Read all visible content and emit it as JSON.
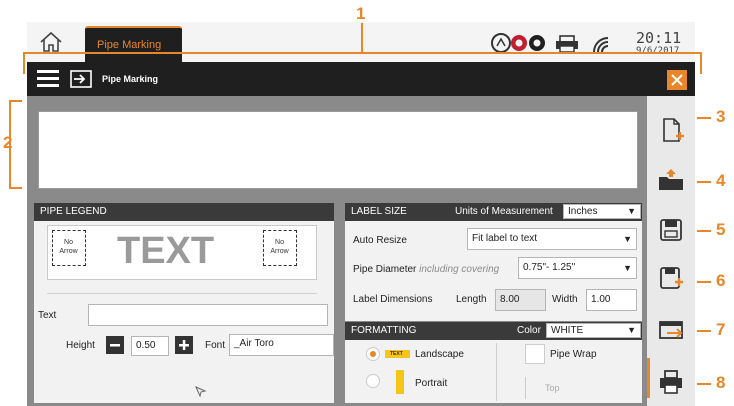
{
  "callouts": {
    "c1": "1",
    "c2": "2",
    "c3": "3",
    "c4": "4",
    "c5": "5",
    "c6": "6",
    "c7": "7",
    "c8": "8"
  },
  "topbar": {
    "tab_label": "Pipe Marking",
    "time": "20:11",
    "date": "9/6/2017"
  },
  "titlebar": {
    "title": "Pipe Marking"
  },
  "pipe_legend": {
    "header": "PIPE LEGEND",
    "left_arrow": [
      "No",
      "Arrow"
    ],
    "legend_text": "TEXT",
    "right_arrow": [
      "No",
      "Arrow"
    ],
    "text_label": "Text",
    "text_value": "",
    "height_label": "Height",
    "height_value": "0.50",
    "font_label": "Font",
    "font_value": "_Air Toro"
  },
  "label_size": {
    "header": "LABEL SIZE",
    "units_label": "Units of Measurement",
    "units_value": "Inches",
    "auto_resize_label": "Auto Resize",
    "auto_resize_value": "Fit label to text",
    "pipe_diameter_label": "Pipe Diameter",
    "pipe_diameter_note": "including covering",
    "pipe_diameter_value": "0.75\"- 1.25\"",
    "label_dimensions_label": "Label Dimensions",
    "length_label": "Length",
    "length_value": "8.00",
    "width_label": "Width",
    "width_value": "1.00"
  },
  "formatting": {
    "header": "FORMATTING",
    "color_label": "Color",
    "color_value": "WHITE",
    "landscape_label": "Landscape",
    "landscape_chip": "TEXT",
    "portrait_label": "Portrait",
    "pipe_wrap_label": "Pipe Wrap",
    "top_label": "Top"
  },
  "colors": {
    "accent": "#e8862a",
    "dark": "#1f1f1f",
    "panel": "#3a3a3a"
  }
}
